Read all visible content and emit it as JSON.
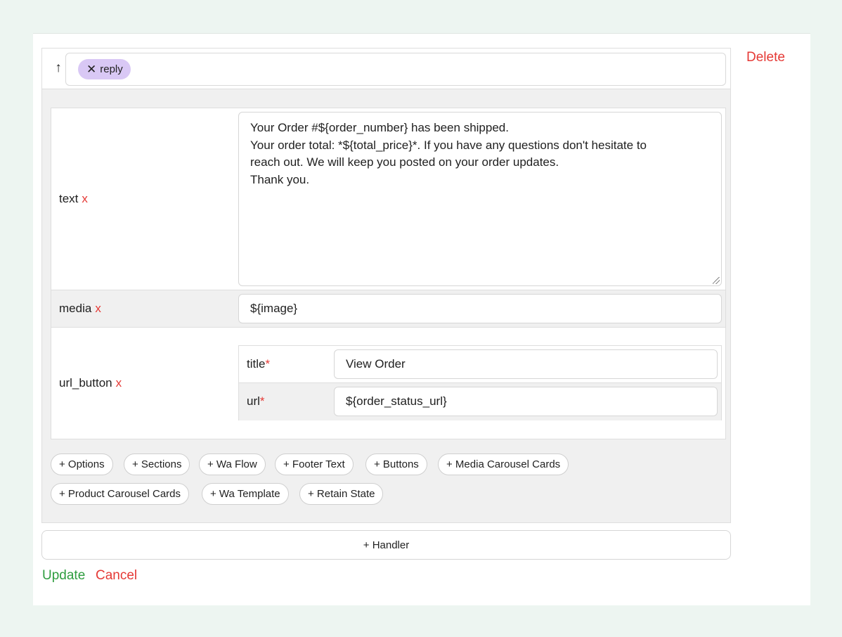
{
  "actions": {
    "delete_label": "Delete",
    "update_label": "Update",
    "cancel_label": "Cancel",
    "handler_label": "+ Handler"
  },
  "header": {
    "tag_label": "reply"
  },
  "fields": {
    "text": {
      "label": "text",
      "remove": "x",
      "value": "Your Order #${order_number} has been shipped.\nYour order total: *${total_price}*. If you have any questions don't hesitate to\nreach out. We will keep you posted on your order updates.\nThank you."
    },
    "media": {
      "label": "media",
      "remove": "x",
      "value": "${image}"
    },
    "url_button": {
      "label": "url_button",
      "remove": "x",
      "title": {
        "label": "title",
        "required": "*",
        "value": "View Order"
      },
      "url": {
        "label": "url",
        "required": "*",
        "value": "${order_status_url}"
      }
    }
  },
  "add_buttons": [
    "+ Options",
    "+ Sections",
    "+ Wa Flow",
    "+ Footer Text",
    "+ Buttons",
    "+ Media Carousel Cards",
    "+ Product Carousel Cards",
    "+ Wa Template",
    "+ Retain State"
  ],
  "colors": {
    "danger": "#e53935",
    "success": "#2e9d3f",
    "chip": "#d9c8f5",
    "page_bg": "#edf5f1"
  },
  "icons": {
    "move_up": "arrow-up-icon",
    "chip_remove": "close-icon",
    "resize": "resize-grip-icon"
  }
}
